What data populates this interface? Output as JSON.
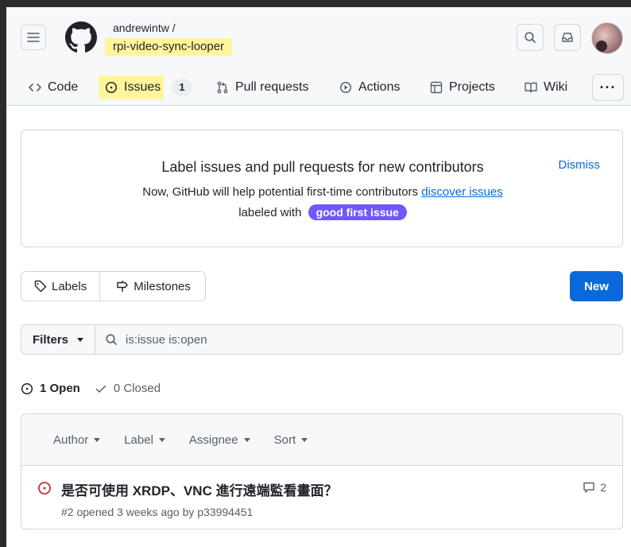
{
  "header": {
    "owner": "andrewintw /",
    "repo": "rpi-video-sync-looper"
  },
  "nav": {
    "code": "Code",
    "issues": "Issues",
    "issues_count": "1",
    "pull_requests": "Pull requests",
    "actions": "Actions",
    "projects": "Projects",
    "wiki": "Wiki",
    "more": "···"
  },
  "banner": {
    "title": "Label issues and pull requests for new contributors",
    "dismiss": "Dismiss",
    "line1_prefix": "Now, GitHub will help potential first-time contributors",
    "line1_link": "discover issues",
    "line2_prefix": "labeled with",
    "label": "good first issue",
    "label_color": "#7057ff"
  },
  "toolbar": {
    "labels": "Labels",
    "milestones": "Milestones",
    "new": "New"
  },
  "filters": {
    "button": "Filters",
    "query": "is:issue is:open"
  },
  "states": {
    "open": "1 Open",
    "closed": "0 Closed"
  },
  "list_header": {
    "author": "Author",
    "label": "Label",
    "assignee": "Assignee",
    "sort": "Sort"
  },
  "issues": [
    {
      "title": "是否可使用 XRDP、VNC 進行遠端監看畫面？",
      "meta": "#2 opened 3 weeks ago by p33994451",
      "comments": "2"
    }
  ],
  "colors": {
    "accent": "#0969da",
    "open_issue": "#cf222e",
    "highlight": "#fff59a"
  }
}
